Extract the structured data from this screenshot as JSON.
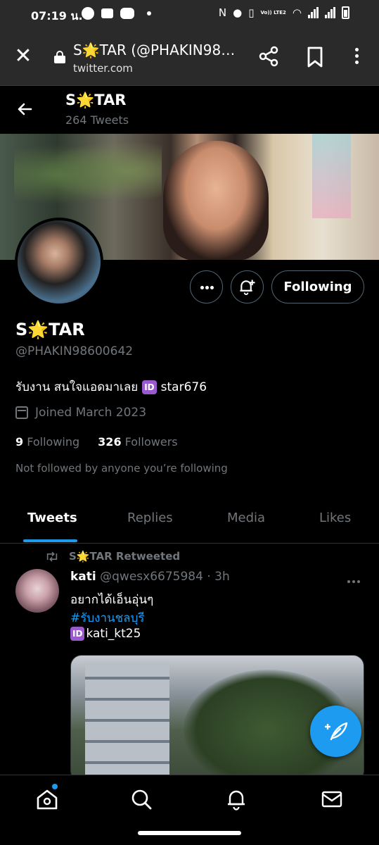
{
  "status_bar": {
    "time": "07:19 น.",
    "volte_label": "Vo)) LTE2"
  },
  "browser": {
    "title": "S🌟TAR (@PHAKIN98…",
    "url": "twitter.com",
    "close_label": "✕"
  },
  "header": {
    "name": "S🌟TAR",
    "tweet_count": "264 Tweets"
  },
  "profile": {
    "display_name": "S🌟TAR",
    "handle": "@PHAKIN98600642",
    "bio_text": "รับงาน สนใจแอดมาเลย",
    "bio_badge": "ID",
    "bio_id": "star676",
    "joined": "Joined March 2023",
    "following_count": "9",
    "following_label": "Following",
    "followers_count": "326",
    "followers_label": "Followers",
    "not_followed": "Not followed by anyone you’re following",
    "follow_button": "Following"
  },
  "tabs": [
    "Tweets",
    "Replies",
    "Media",
    "Likes"
  ],
  "tweet": {
    "retweeted_by": "S🌟TAR Retweeted",
    "author": "kati",
    "meta": "@qwesx6675984 · 3h",
    "line1": "อยากได้เอ็นอุ่นๆ",
    "hashtag": "#รับงานชลบุรี",
    "id_badge": "ID",
    "id_text": "kati_kt25"
  },
  "colors": {
    "accent": "#1d9bf0",
    "muted": "#71767b",
    "badge": "#9b59d0"
  },
  "icons": {
    "back": "arrow-left-icon",
    "share": "share-icon",
    "bookmark": "bookmark-icon",
    "menu": "more-vertical-icon",
    "notify": "bell-plus-icon",
    "compose": "feather-plus-icon",
    "home": "home-icon",
    "search": "search-icon",
    "notifications": "bell-icon",
    "messages": "mail-icon"
  }
}
